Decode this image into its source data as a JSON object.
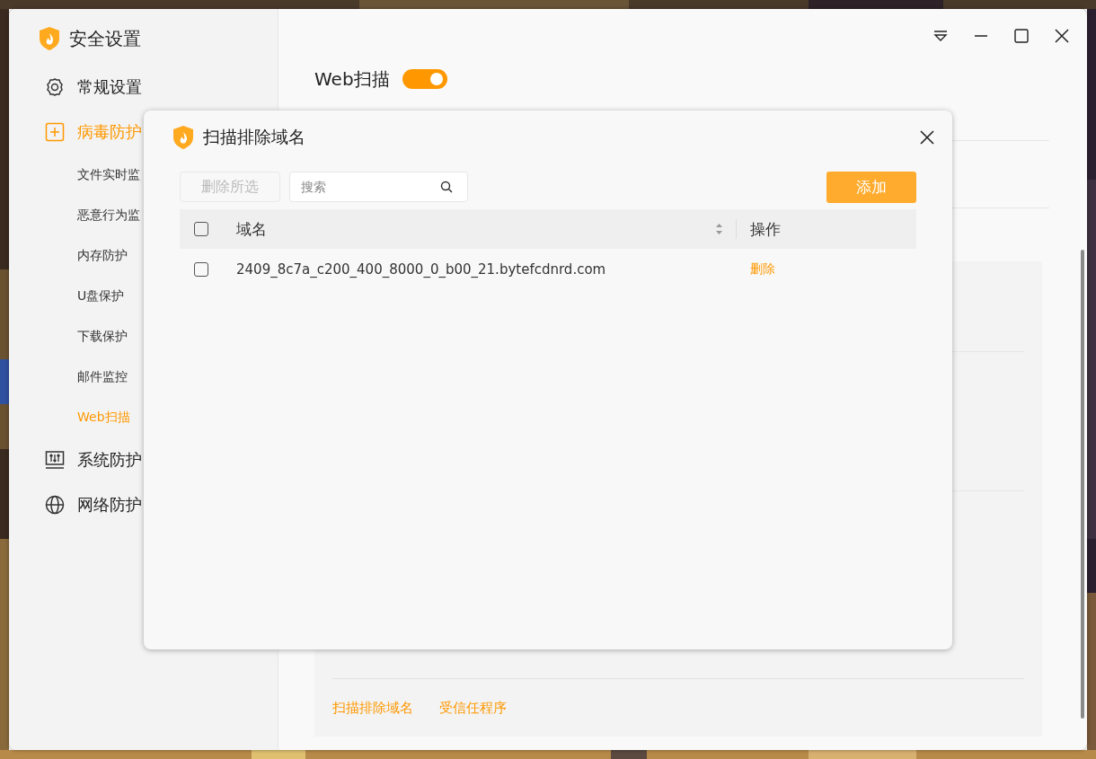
{
  "window": {
    "title": "安全设置"
  },
  "sidebar": {
    "items": [
      {
        "label": "常规设置",
        "selected": false
      },
      {
        "label": "病毒防护",
        "selected": true,
        "children": [
          {
            "label": "文件实时监",
            "selected": false
          },
          {
            "label": "恶意行为监",
            "selected": false
          },
          {
            "label": "内存防护",
            "selected": false
          },
          {
            "label": "U盘保护",
            "selected": false
          },
          {
            "label": "下载保护",
            "selected": false
          },
          {
            "label": "邮件监控",
            "selected": false
          },
          {
            "label": "Web扫描",
            "selected": true
          }
        ]
      },
      {
        "label": "系统防护",
        "selected": false
      },
      {
        "label": "网络防护",
        "selected": false
      }
    ]
  },
  "header": {
    "title": "Web扫描",
    "toggle_on": true
  },
  "links": [
    "扫描排除域名",
    "受信任程序"
  ],
  "dialog": {
    "title": "扫描排除域名",
    "delete_selected": {
      "label": "删除所选",
      "disabled": true
    },
    "search": {
      "placeholder": "搜索"
    },
    "add_button": "添加",
    "columns": [
      "域名",
      "操作"
    ],
    "header_checked": false,
    "rows": [
      {
        "domain": "2409_8c7a_c200_400_8000_0_b00_21.bytefcdnrd.com",
        "checked": false,
        "action": "删除"
      }
    ]
  }
}
